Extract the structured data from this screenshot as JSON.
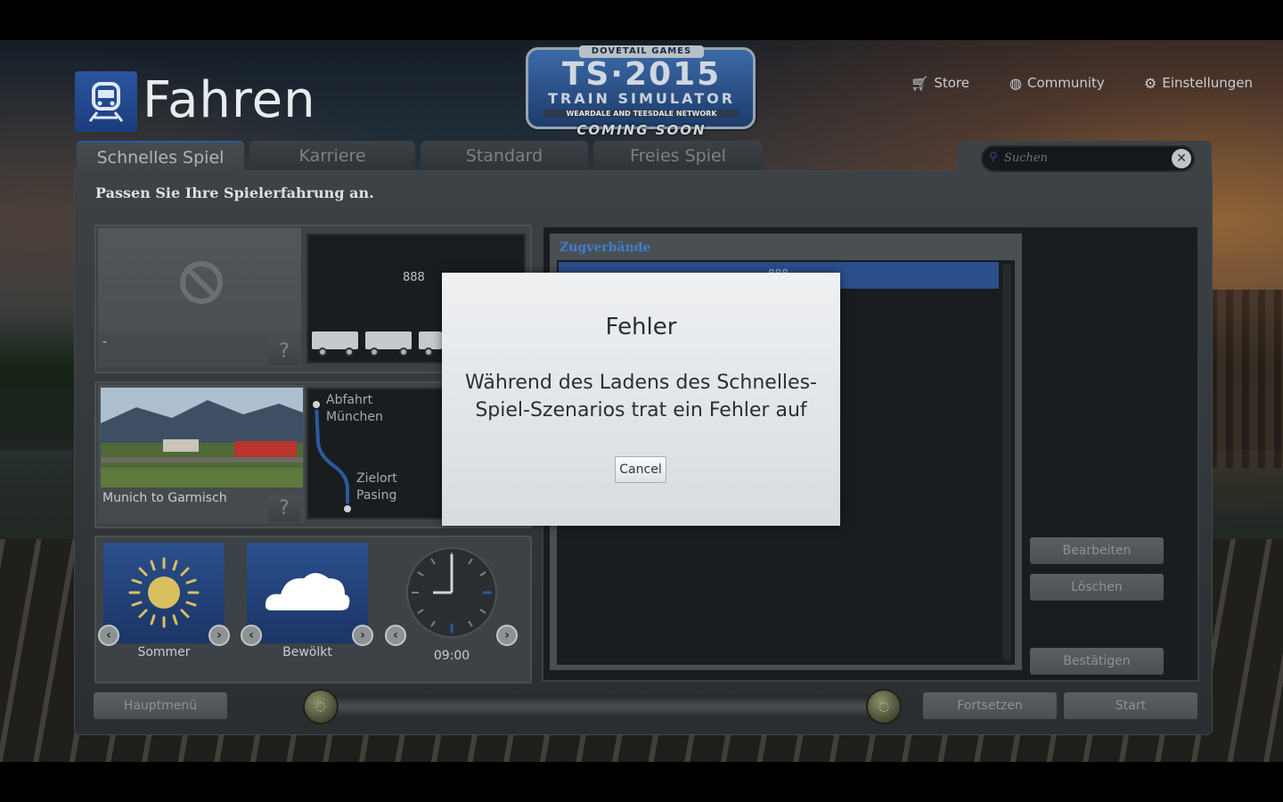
{
  "header": {
    "page_title": "Fahren",
    "logo": {
      "publisher": "DOVETAIL GAMES",
      "title": "TS·2015",
      "subtitle": "TRAIN SIMULATOR",
      "network": "WEARDALE AND TEESDALE NETWORK",
      "banner": "COMING SOON"
    },
    "links": {
      "store": "Store",
      "community": "Community",
      "settings": "Einstellungen"
    }
  },
  "tabs": [
    "Schnelles Spiel",
    "Karriere",
    "Standard",
    "Freies Spiel"
  ],
  "active_tab": "Schnelles Spiel",
  "search": {
    "placeholder": "Suchen"
  },
  "subtitle": "Passen Sie Ihre Spielerfahrung an.",
  "loco": {
    "name": "-",
    "help": "?"
  },
  "consist_preview": {
    "label": "888"
  },
  "route": {
    "name": "Munich to Garmisch",
    "help": "?",
    "departure_label": "Abfahrt",
    "departure": "München",
    "destination_label": "Zielort",
    "destination": "Pasing"
  },
  "conditions": {
    "season": "Sommer",
    "weather": "Bewölkt",
    "time": "09:00"
  },
  "zugverbande": {
    "header": "Zugverbände",
    "selected_label": "888"
  },
  "side_buttons": {
    "edit": "Bearbeiten",
    "delete": "Löschen",
    "confirm": "Bestätigen"
  },
  "bottom": {
    "main_menu": "Hauptmenü",
    "continue": "Fortsetzen",
    "start": "Start"
  },
  "dialog": {
    "title": "Fehler",
    "message": "Während des Ladens des Schnelles-Spiel-Szenarios trat ein Fehler auf",
    "cancel": "Cancel"
  },
  "colors": {
    "accent": "#2b4f8c",
    "header_accent": "#3e7fd0",
    "panel": "#3d4246",
    "dialog": "#e4e7ea"
  }
}
